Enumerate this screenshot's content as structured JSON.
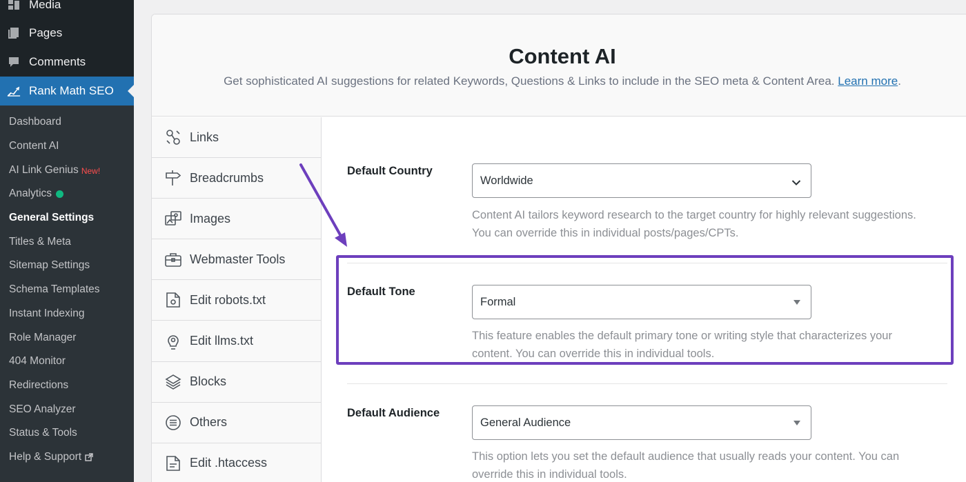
{
  "sidebar": {
    "top_items": [
      {
        "label": "Media",
        "icon": "media-icon"
      },
      {
        "label": "Pages",
        "icon": "pages-icon"
      },
      {
        "label": "Comments",
        "icon": "comments-icon"
      },
      {
        "label": "Rank Math SEO",
        "icon": "rank-math-icon"
      }
    ],
    "submenu": [
      {
        "label": "Dashboard"
      },
      {
        "label": "Content AI"
      },
      {
        "label": "AI Link Genius",
        "badge": "New!"
      },
      {
        "label": "Analytics"
      },
      {
        "label": "General Settings"
      },
      {
        "label": "Titles & Meta"
      },
      {
        "label": "Sitemap Settings"
      },
      {
        "label": "Schema Templates"
      },
      {
        "label": "Instant Indexing"
      },
      {
        "label": "Role Manager"
      },
      {
        "label": "404 Monitor"
      },
      {
        "label": "Redirections"
      },
      {
        "label": "SEO Analyzer"
      },
      {
        "label": "Status & Tools"
      },
      {
        "label": "Help & Support"
      }
    ]
  },
  "header": {
    "title": "Content AI",
    "description": "Get sophisticated AI suggestions for related Keywords, Questions & Links to include in the SEO meta & Content Area.",
    "learn_more": "Learn more",
    "period": "."
  },
  "tabs": [
    {
      "label": "Links",
      "icon": "links-icon"
    },
    {
      "label": "Breadcrumbs",
      "icon": "signpost-icon"
    },
    {
      "label": "Images",
      "icon": "images-icon"
    },
    {
      "label": "Webmaster Tools",
      "icon": "briefcase-icon"
    },
    {
      "label": "Edit robots.txt",
      "icon": "robots-file-icon"
    },
    {
      "label": "Edit llms.txt",
      "icon": "llms-icon"
    },
    {
      "label": "Blocks",
      "icon": "blocks-icon"
    },
    {
      "label": "Others",
      "icon": "others-icon"
    },
    {
      "label": "Edit .htaccess",
      "icon": "htaccess-file-icon"
    }
  ],
  "settings": {
    "country": {
      "label": "Default Country",
      "value": "Worldwide",
      "description": "Content AI tailors keyword research to the target country for highly relevant suggestions. You can override this in individual posts/pages/CPTs."
    },
    "tone": {
      "label": "Default Tone",
      "value": "Formal",
      "description": "This feature enables the default primary tone or writing style that characterizes your content. You can override this in individual tools."
    },
    "audience": {
      "label": "Default Audience",
      "value": "General Audience",
      "description": "This option lets you set the default audience that usually reads your content. You can override this in individual tools."
    }
  },
  "colors": {
    "sidebar_bg": "#1d2327",
    "submenu_bg": "#2c3338",
    "accent": "#2271b1",
    "annotation": "#6d3fbd",
    "status_green": "#10b981"
  }
}
